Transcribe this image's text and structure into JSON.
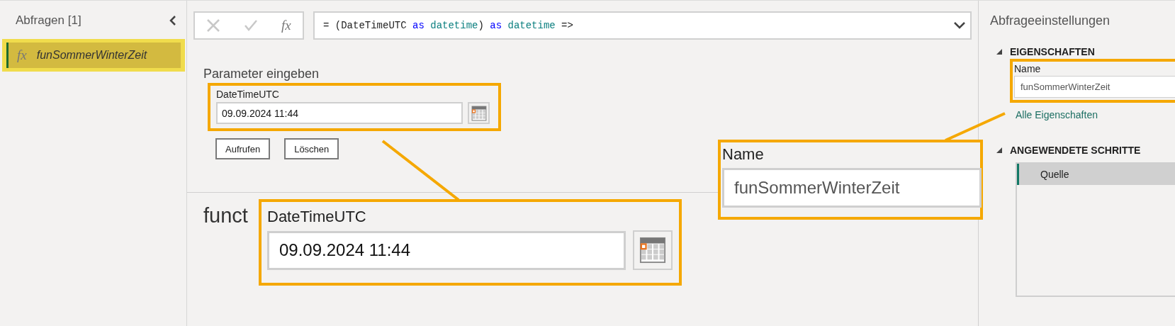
{
  "queries_pane": {
    "title": "Abfragen [1]",
    "items": [
      {
        "icon_glyph": "fx",
        "label": "funSommerWinterZeit",
        "selected": true,
        "highlighted": true
      }
    ]
  },
  "formula_bar": {
    "function_glyph": "fx",
    "tokens": [
      {
        "text": "= (DateTimeUTC ",
        "kind": "plain"
      },
      {
        "text": "as",
        "kind": "keyword"
      },
      {
        "text": " datetime",
        "kind": "type"
      },
      {
        "text": ") ",
        "kind": "plain"
      },
      {
        "text": "as",
        "kind": "keyword"
      },
      {
        "text": " datetime",
        "kind": "type"
      },
      {
        "text": " =>",
        "kind": "plain"
      }
    ]
  },
  "parameter_panel": {
    "title": "Parameter eingeben",
    "parameters": [
      {
        "label": "DateTimeUTC",
        "value": "09.09.2024 11:44",
        "highlighted": true
      }
    ],
    "buttons": [
      "Aufrufen",
      "Löschen"
    ]
  },
  "function_heading": "funct",
  "settings_pane": {
    "title": "Abfrageeinstellungen",
    "properties": {
      "heading": "EIGENSCHAFTEN",
      "name_label": "Name",
      "name_value": "funSommerWinterZeit",
      "highlighted": true,
      "link": "Alle Eigenschaften"
    },
    "steps": {
      "heading": "ANGEWENDETE SCHRITTE",
      "items": [
        {
          "label": "Quelle",
          "selected": true
        }
      ]
    }
  },
  "callouts": [
    {
      "kind": "parameter",
      "label": "DateTimeUTC",
      "value": "09.09.2024 11:44"
    },
    {
      "kind": "name",
      "label": "Name",
      "value": "funSommerWinterZeit"
    }
  ]
}
